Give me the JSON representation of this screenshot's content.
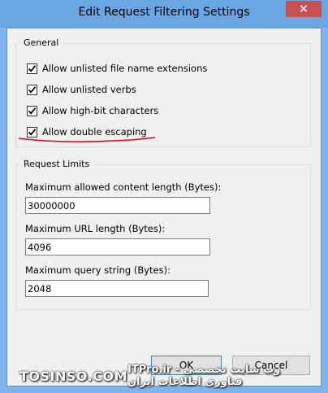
{
  "window": {
    "title": "Edit Request Filtering Settings",
    "close_glyph": "✕"
  },
  "general": {
    "legend": "General",
    "options": [
      {
        "label": "Allow unlisted file name extensions",
        "checked": true
      },
      {
        "label": "Allow unlisted verbs",
        "checked": true
      },
      {
        "label": "Allow high-bit characters",
        "checked": true
      },
      {
        "label": "Allow double escaping",
        "checked": true
      }
    ]
  },
  "limits": {
    "legend": "Request Limits",
    "content_length_label": "Maximum allowed content length (Bytes):",
    "content_length_value": "30000000",
    "url_length_label": "Maximum URL length (Bytes):",
    "url_length_value": "4096",
    "query_string_label": "Maximum query string (Bytes):",
    "query_string_value": "2048"
  },
  "buttons": {
    "ok": "OK",
    "cancel": "Cancel"
  },
  "watermark": {
    "left": "TOSINSO.COM",
    "right": "ITPro.ir - وب سایت تخصصی فناوری اطلاعات ایران"
  },
  "colors": {
    "titlebar": "#6aa6e4",
    "close_button": "#c75050",
    "annotation_red": "#e0001b"
  }
}
